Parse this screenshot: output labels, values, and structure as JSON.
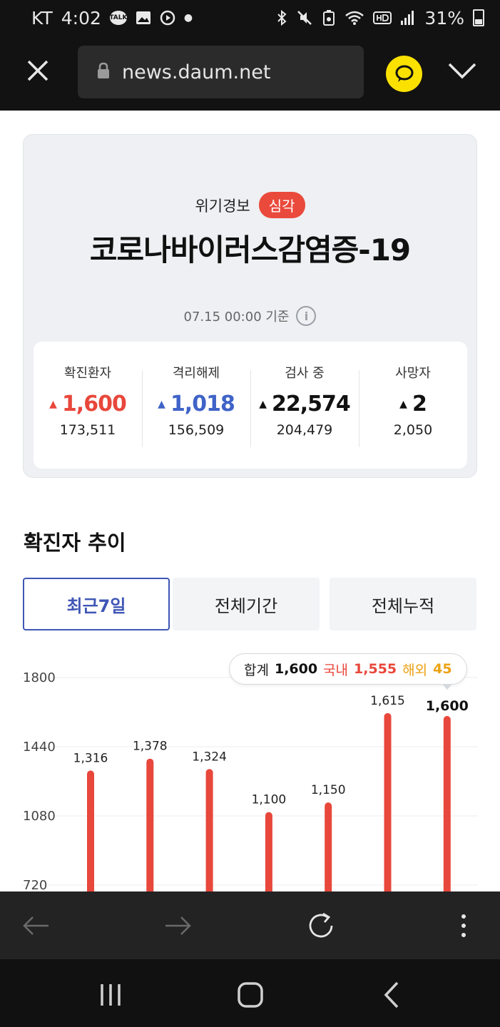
{
  "status_bar": {
    "carrier": "KT",
    "time": "4:02",
    "talk_label": "TALK",
    "battery": "31%"
  },
  "browser": {
    "url": "news.daum.net"
  },
  "alert": {
    "label": "위기경보",
    "level": "심각"
  },
  "virus_title": "코로나바이러스감염증-19",
  "basis": "07.15 00:00 기준",
  "info_glyph": "i",
  "stats": [
    {
      "label": "확진환자",
      "delta": "1,600",
      "total": "173,511",
      "color": "#e8473b"
    },
    {
      "label": "격리해제",
      "delta": "1,018",
      "total": "156,509",
      "color": "#3f63c7"
    },
    {
      "label": "검사 중",
      "delta": "22,574",
      "total": "204,479",
      "color": "#111111"
    },
    {
      "label": "사망자",
      "delta": "2",
      "total": "2,050",
      "color": "#111111"
    }
  ],
  "section_title": "확진자 추이",
  "tabs": [
    {
      "label": "최근7일",
      "active": true
    },
    {
      "label": "전체기간",
      "active": false
    },
    {
      "label": "전체누적",
      "active": false
    }
  ],
  "tooltip": {
    "total_label": "합계",
    "total_value": "1,600",
    "domestic_label": "국내",
    "domestic_value": "1,555",
    "overseas_label": "해외",
    "overseas_value": "45"
  },
  "chart_data": {
    "type": "bar",
    "y_ticks": [
      1800,
      1440,
      1080,
      720
    ],
    "value_labels": [
      "1,316",
      "1,378",
      "1,324",
      "1,100",
      "1,150",
      "1,615",
      "1,600"
    ],
    "values": [
      1316,
      1378,
      1324,
      1100,
      1150,
      1615,
      1600
    ],
    "bar_color": "#e8473b",
    "grid": true
  },
  "icons": {
    "close": "close-icon",
    "lock": "lock-icon",
    "kakao": "kakao-talk-icon",
    "chevron": "chevron-down-icon",
    "back": "arrow-left-icon",
    "forward": "arrow-right-icon",
    "refresh": "refresh-icon",
    "more": "more-vert-icon"
  }
}
